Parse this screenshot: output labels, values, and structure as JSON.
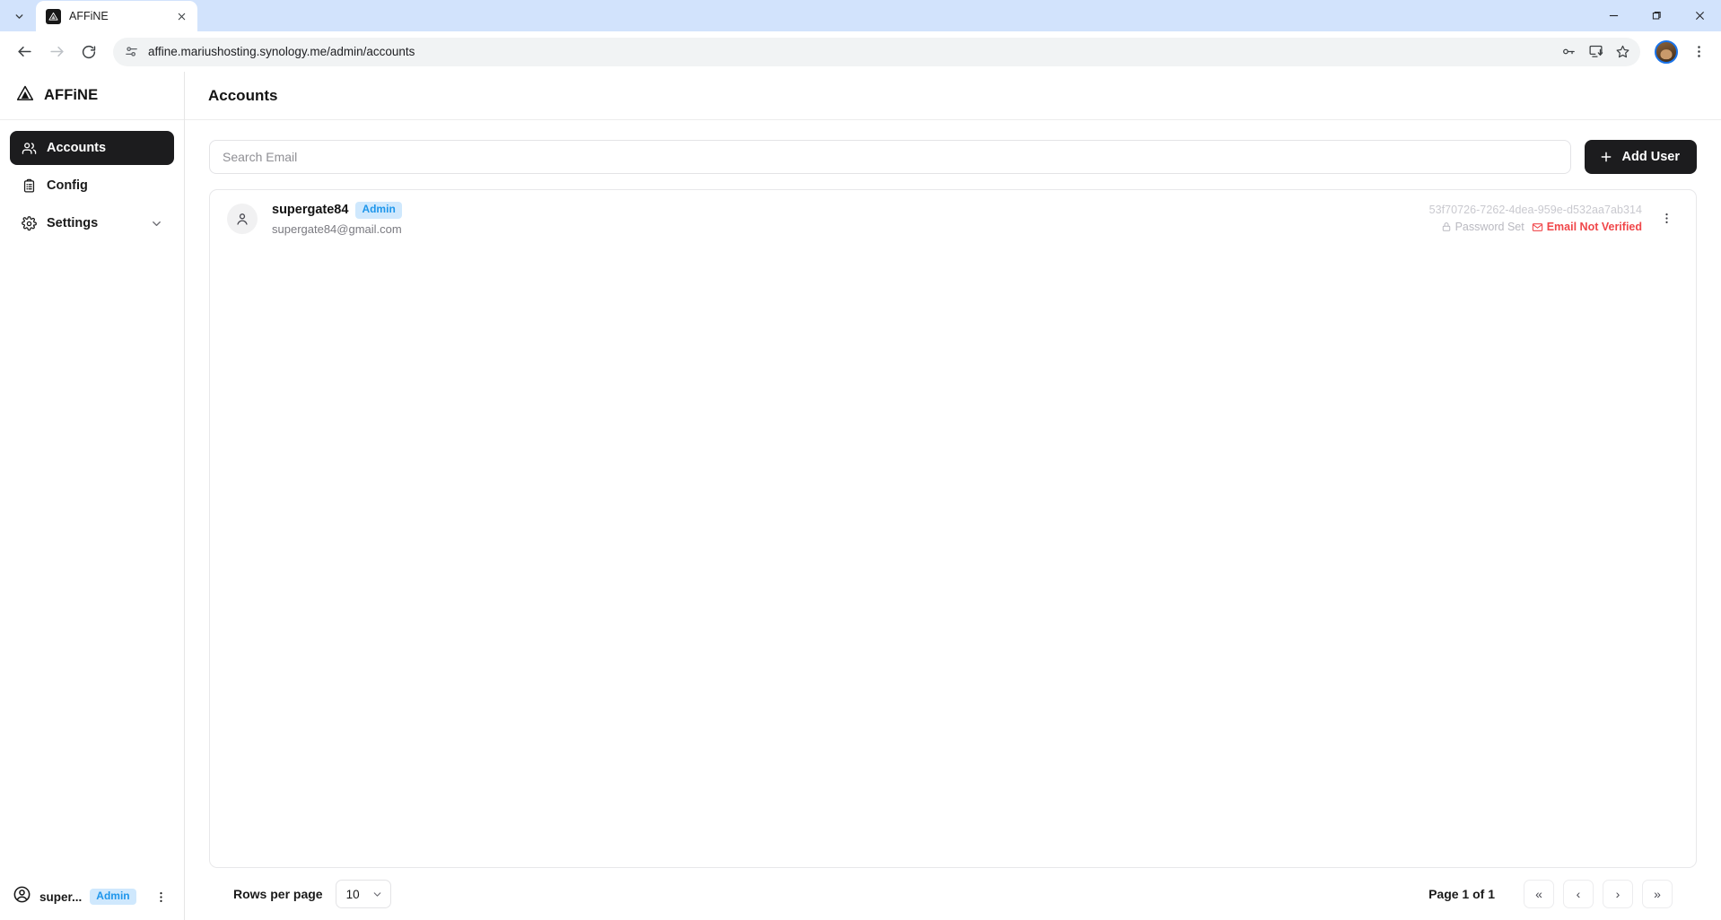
{
  "browser": {
    "tab": {
      "title": "AFFiNE",
      "favicon_icon": "affine-logo-icon"
    },
    "tab_list_icon": "chevron-down-icon",
    "tab_close_icon": "close-icon",
    "back_icon": "arrow-left-icon",
    "forward_icon": "arrow-right-icon",
    "reload_icon": "reload-icon",
    "site_info_icon": "tune-icon",
    "url": "affine.mariushosting.synology.me/admin/accounts",
    "omni_icons": [
      "key-icon",
      "install-app-icon",
      "bookmark-star-icon"
    ],
    "profile_icon": "profile-avatar",
    "menu_icon": "kebab-menu-icon",
    "window": {
      "minimize_icon": "minimize-icon",
      "maximize_icon": "maximize-icon",
      "close_icon": "window-close-icon"
    }
  },
  "sidebar": {
    "brand": "AFFiNE",
    "brand_icon": "affine-triangle-logo-icon",
    "items": [
      {
        "label": "Accounts",
        "icon": "users-icon",
        "active": true
      },
      {
        "label": "Config",
        "icon": "clipboard-list-icon",
        "active": false
      },
      {
        "label": "Settings",
        "icon": "gear-icon",
        "active": false,
        "chevron": "chevron-down-icon"
      }
    ],
    "footer": {
      "avatar_icon": "user-circle-icon",
      "name": "super...",
      "badge": "Admin",
      "menu_icon": "kebab-menu-icon"
    }
  },
  "main": {
    "title": "Accounts",
    "search": {
      "placeholder": "Search Email",
      "value": ""
    },
    "add_user": {
      "label": "Add User",
      "icon": "plus-icon"
    },
    "accounts": [
      {
        "avatar_icon": "person-icon",
        "name": "supergate84",
        "badge": "Admin",
        "email": "supergate84@gmail.com",
        "id": "53f70726-7262-4dea-959e-d532aa7ab314",
        "password_status": {
          "label": "Password Set",
          "icon": "lock-icon"
        },
        "email_status": {
          "label": "Email Not Verified",
          "icon": "mail-icon"
        },
        "menu_icon": "kebab-menu-icon"
      }
    ],
    "footer": {
      "rows_per_page_label": "Rows per page",
      "rows_per_page_value": "10",
      "rows_per_page_chevron": "chevron-down-icon",
      "page_info": "Page 1 of 1",
      "pager": [
        {
          "label": "«",
          "name": "first-page-button"
        },
        {
          "label": "‹",
          "name": "previous-page-button"
        },
        {
          "label": "›",
          "name": "next-page-button"
        },
        {
          "label": "»",
          "name": "last-page-button"
        }
      ]
    }
  },
  "colors": {
    "accent_dark": "#1c1c1e",
    "badge_bg": "#cfe8fd",
    "badge_text": "#1e96eb",
    "danger": "#f0474a",
    "chrome_bg": "#d2e3fc"
  }
}
